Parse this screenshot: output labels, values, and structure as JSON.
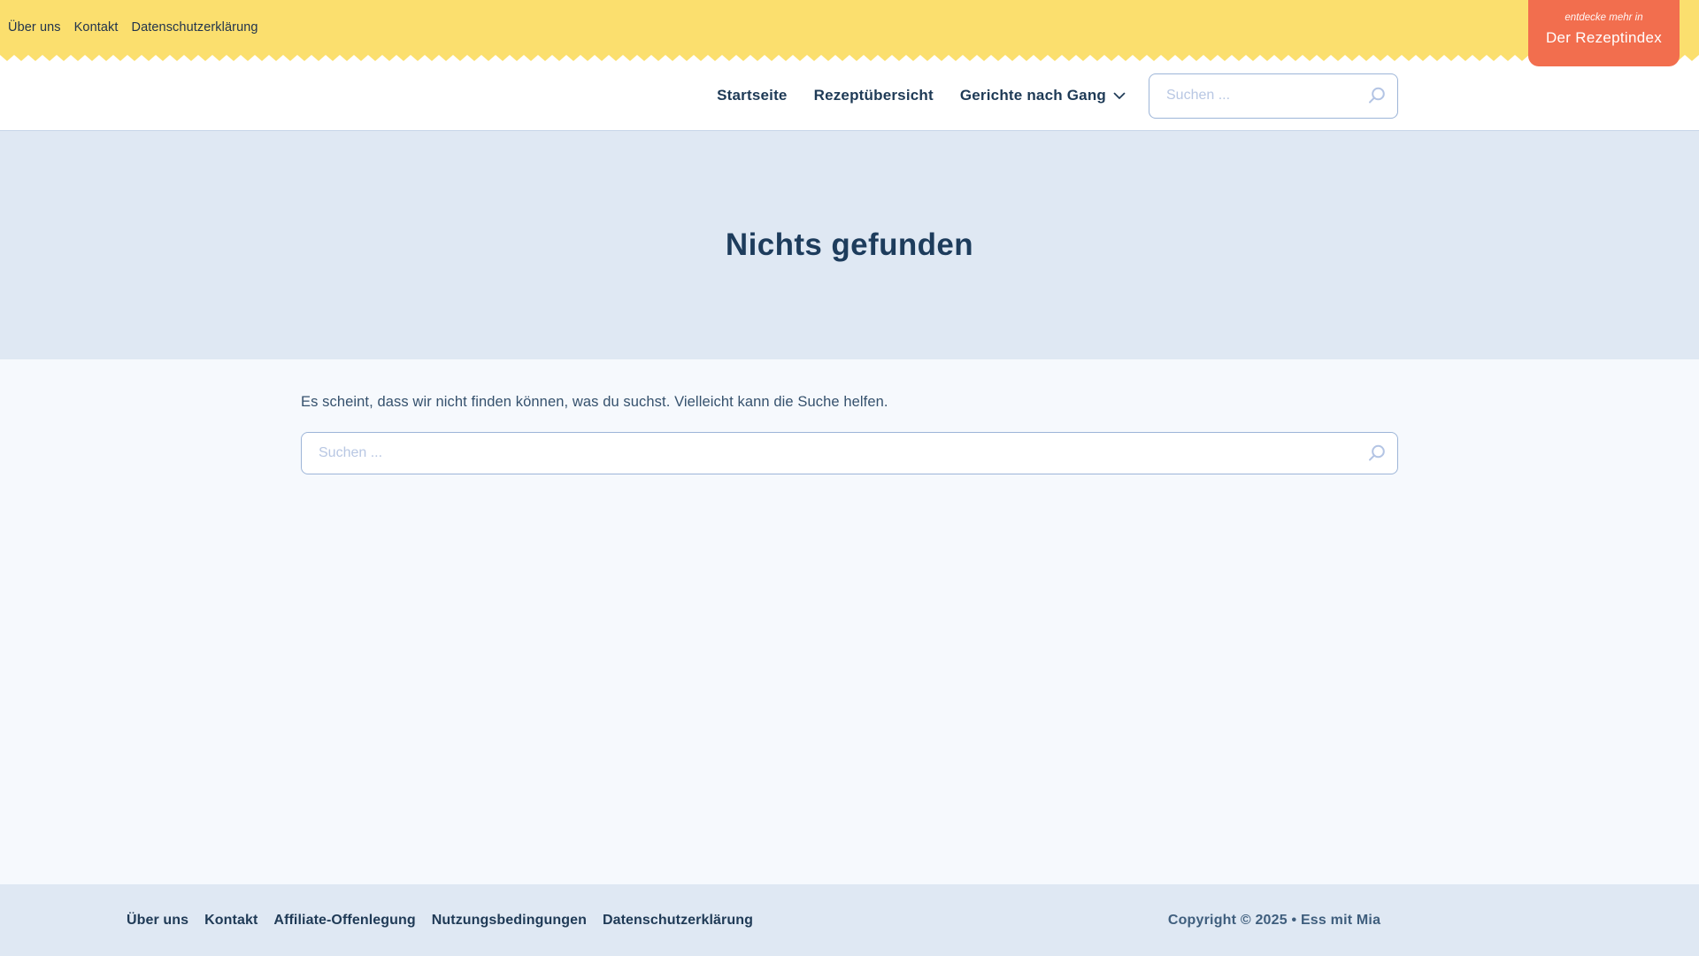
{
  "topbar": {
    "links": [
      "Über uns",
      "Kontakt",
      "Datenschutzerklärung"
    ],
    "badge": {
      "eyebrow": "entdecke mehr in",
      "title": "Der Rezeptindex"
    }
  },
  "header": {
    "nav": [
      {
        "label": "Startseite"
      },
      {
        "label": "Rezeptübersicht"
      },
      {
        "label": "Gerichte nach Gang",
        "dropdown_icon": "chevron-down"
      }
    ],
    "search": {
      "placeholder": "Suchen ...",
      "icon": "search-magnifier"
    }
  },
  "hero": {
    "title": "Nichts gefunden"
  },
  "content": {
    "message": "Es scheint, dass wir nicht finden können, was du suchst. Vielleicht kann die Suche helfen.",
    "search": {
      "placeholder": "Suchen ...",
      "icon": "search-magnifier"
    }
  },
  "footer": {
    "links": [
      "Über uns",
      "Kontakt",
      "Affiliate-Offenlegung",
      "Nutzungsbedingungen",
      "Datenschutzerklärung"
    ],
    "copyright": "Copyright © 2025 • Ess mit Mia"
  },
  "colors": {
    "topbar_yellow": "#fbdf6e",
    "badge_coral": "#f26e4e",
    "navy_text": "#1e3a56",
    "hero_footer_bg": "#dfe8f3",
    "content_bg": "#f6f9fd",
    "search_border": "#9db5d8",
    "placeholder_text": "#b8c7e3"
  }
}
